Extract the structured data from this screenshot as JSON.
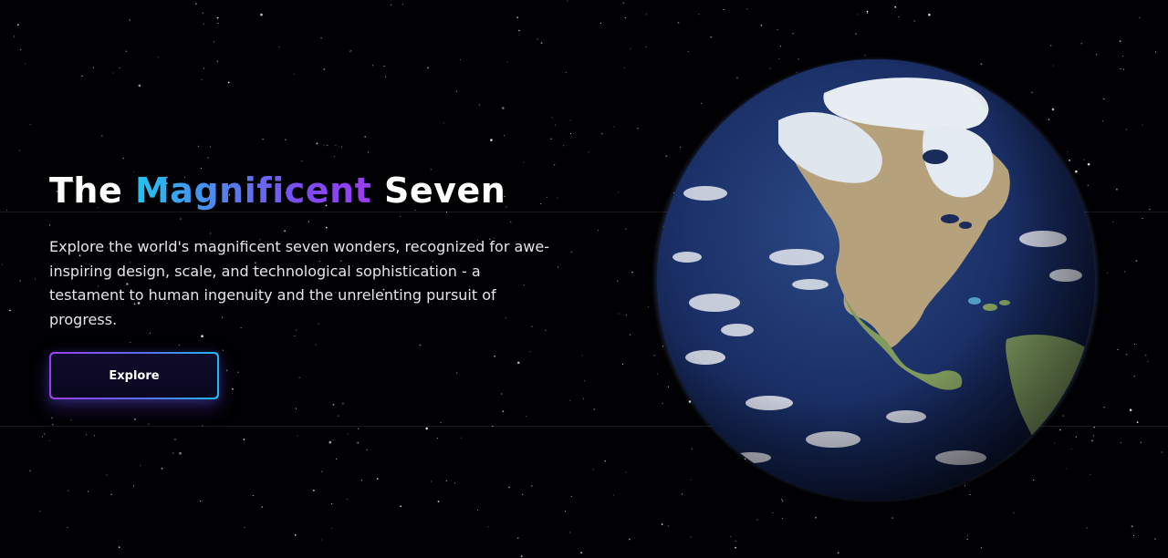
{
  "hero": {
    "title_part1": "The",
    "title_highlight": "Magnificent",
    "title_part2": "Seven",
    "description": "Explore the world's magnificent seven wonders, recognized for awe-inspiring design, scale, and technological sophistication - a testament to human ingenuity and the unrelenting pursuit of progress.",
    "cta_label": "Explore"
  },
  "colors": {
    "background": "#010103",
    "highlight_gradient": [
      "#22c3f0",
      "#4f86ee",
      "#7b4cf0",
      "#9a3cf2"
    ],
    "button_border_gradient": [
      "#9b3cf2",
      "#5a6cf0",
      "#22b7f0"
    ],
    "button_fill": "#0f0b2a",
    "text": "#ffffff"
  },
  "visual": {
    "globe": "earth-globe-north-america",
    "background": "starfield"
  }
}
